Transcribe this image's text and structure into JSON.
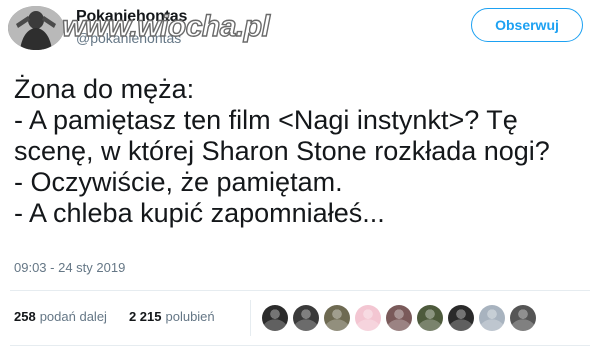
{
  "header": {
    "display_name": "Pokaniehontas",
    "handle": "@pokaniehontas",
    "follow_label": "Obserwuj",
    "watermark": "www.wiocha.pl"
  },
  "tweet": {
    "lines": [
      "Żona do męża:",
      "- A pamiętasz ten film <Nagi instynkt>? Tę",
      "scenę, w której Sharon Stone rozkłada nogi?",
      "- Oczywiście, że pamiętam.",
      "- A chleba kupić zapomniałeś..."
    ],
    "timestamp": "09:03 - 24 sty 2019"
  },
  "stats": {
    "retweets_count": "258",
    "retweets_label": "podań dalej",
    "likes_count": "2 215",
    "likes_label": "polubień"
  },
  "likers": [
    {
      "color": "#2b2b2b"
    },
    {
      "color": "#3a3a3a"
    },
    {
      "color": "#6e6a52"
    },
    {
      "color": "#f3c6d2"
    },
    {
      "color": "#7a5a5a"
    },
    {
      "color": "#4d5a3c"
    },
    {
      "color": "#2a2a2a"
    },
    {
      "color": "#a8b3bf"
    },
    {
      "color": "#555555"
    }
  ],
  "colors": {
    "accent": "#1da1f2",
    "secondary_text": "#657786",
    "primary_text": "#14171a",
    "divider": "#e6ecf0"
  }
}
